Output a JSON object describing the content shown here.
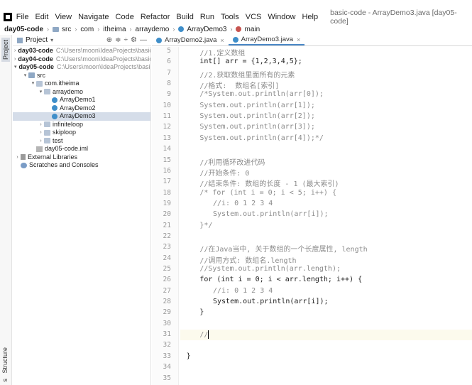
{
  "menubar": {
    "items": [
      "File",
      "Edit",
      "View",
      "Navigate",
      "Code",
      "Refactor",
      "Build",
      "Run",
      "Tools",
      "VCS",
      "Window",
      "Help"
    ],
    "window_title": "basic-code - ArrayDemo3.java [day05-code]"
  },
  "breadcrumb": [
    "day05-code",
    "src",
    "com",
    "itheima",
    "arraydemo",
    "ArrayDemo3",
    "main"
  ],
  "project_panel": {
    "title": "Project",
    "tools": [
      "⊕",
      "≑",
      "÷",
      "⚙",
      "—"
    ],
    "tree": [
      {
        "indent": 0,
        "arrow": ">",
        "icon": "folder",
        "name": "day03-code",
        "bold": true,
        "path": "C:\\Users\\moon\\IdeaProjects\\basic-code"
      },
      {
        "indent": 0,
        "arrow": ">",
        "icon": "folder",
        "name": "day04-code",
        "bold": true,
        "path": "C:\\Users\\moon\\IdeaProjects\\basic-code"
      },
      {
        "indent": 0,
        "arrow": "v",
        "icon": "folder",
        "name": "day05-code",
        "bold": true,
        "path": "C:\\Users\\moon\\IdeaProjects\\basic-code"
      },
      {
        "indent": 1,
        "arrow": "v",
        "icon": "folder",
        "name": "src",
        "bold": false,
        "path": ""
      },
      {
        "indent": 2,
        "arrow": "v",
        "icon": "pkg",
        "name": "com.itheima",
        "bold": false,
        "path": ""
      },
      {
        "indent": 3,
        "arrow": "v",
        "icon": "pkg",
        "name": "arraydemo",
        "bold": false,
        "path": ""
      },
      {
        "indent": 4,
        "arrow": "",
        "icon": "cls",
        "name": "ArrayDemo1",
        "bold": false,
        "path": ""
      },
      {
        "indent": 4,
        "arrow": "",
        "icon": "cls",
        "name": "ArrayDemo2",
        "bold": false,
        "path": ""
      },
      {
        "indent": 4,
        "arrow": "",
        "icon": "cls",
        "name": "ArrayDemo3",
        "bold": false,
        "path": "",
        "selected": true
      },
      {
        "indent": 3,
        "arrow": ">",
        "icon": "pkg",
        "name": "infiniteloop",
        "bold": false,
        "path": ""
      },
      {
        "indent": 3,
        "arrow": ">",
        "icon": "pkg",
        "name": "skiploop",
        "bold": false,
        "path": ""
      },
      {
        "indent": 3,
        "arrow": ">",
        "icon": "pkg",
        "name": "test",
        "bold": false,
        "path": ""
      },
      {
        "indent": 2,
        "arrow": "",
        "icon": "iml",
        "name": "day05-code.iml",
        "bold": false,
        "path": ""
      },
      {
        "indent": 0,
        "arrow": ">",
        "icon": "lib",
        "name": "External Libraries",
        "bold": false,
        "path": ""
      },
      {
        "indent": 0,
        "arrow": "",
        "icon": "scr",
        "name": "Scratches and Consoles",
        "bold": false,
        "path": ""
      }
    ]
  },
  "side_tabs": {
    "project": "Project",
    "structure": "Structure",
    "bottom": "s"
  },
  "tabs": [
    {
      "label": "ArrayDemo2.java",
      "active": false
    },
    {
      "label": "ArrayDemo3.java",
      "active": true
    }
  ],
  "editor": {
    "line_numbers": [
      "5",
      "6",
      "7",
      "8",
      "9",
      "10",
      "11",
      "12",
      "13",
      "14",
      "15",
      "16",
      "17",
      "18",
      "19",
      "20",
      "21",
      "22",
      "23",
      "24",
      "25",
      "26",
      "27",
      "28",
      "29",
      "30",
      "31",
      "32",
      "33",
      "34",
      "35"
    ],
    "current_line": "31",
    "lines": [
      {
        "n": "5",
        "indent": 4,
        "t": "//1.定义数组",
        "style": "comment"
      },
      {
        "n": "6",
        "indent": 4,
        "t": "int[] arr = {1,2,3,4,5};",
        "style": "code"
      },
      {
        "n": "7",
        "indent": 4,
        "t": "//2.获取数组里面所有的元素",
        "style": "comment"
      },
      {
        "n": "8",
        "indent": 4,
        "t": "//格式:  数组名[索引]",
        "style": "comment"
      },
      {
        "n": "9",
        "indent": 4,
        "t": "/*System.out.println(arr[0]);",
        "style": "comment"
      },
      {
        "n": "10",
        "indent": 4,
        "t": "System.out.println(arr[1]);",
        "style": "comment"
      },
      {
        "n": "11",
        "indent": 4,
        "t": "System.out.println(arr[2]);",
        "style": "comment"
      },
      {
        "n": "12",
        "indent": 4,
        "t": "System.out.println(arr[3]);",
        "style": "comment"
      },
      {
        "n": "13",
        "indent": 4,
        "t": "System.out.println(arr[4]);*/",
        "style": "comment"
      },
      {
        "n": "14",
        "indent": 4,
        "t": "",
        "style": "code"
      },
      {
        "n": "15",
        "indent": 4,
        "t": "//利用循环改进代码",
        "style": "comment"
      },
      {
        "n": "16",
        "indent": 4,
        "t": "//开始条件: 0",
        "style": "comment"
      },
      {
        "n": "17",
        "indent": 4,
        "t": "//结束条件: 数组的长度 - 1 (最大索引)",
        "style": "comment"
      },
      {
        "n": "18",
        "indent": 4,
        "t": "/* for (int i = 0; i < 5; i++) {",
        "style": "comment"
      },
      {
        "n": "19",
        "indent": 6,
        "t": "//i: 0 1 2 3 4",
        "style": "comment"
      },
      {
        "n": "20",
        "indent": 6,
        "t": "System.out.println(arr[i]);",
        "style": "comment"
      },
      {
        "n": "21",
        "indent": 4,
        "t": "}*/",
        "style": "comment"
      },
      {
        "n": "22",
        "indent": 4,
        "t": "",
        "style": "code"
      },
      {
        "n": "23",
        "indent": 4,
        "t": "//在Java当中, 关于数组的一个长度属性, length",
        "style": "comment"
      },
      {
        "n": "24",
        "indent": 4,
        "t": "//调用方式: 数组名.length",
        "style": "comment"
      },
      {
        "n": "25",
        "indent": 4,
        "t": "//System.out.println(arr.length);",
        "style": "comment"
      },
      {
        "n": "26",
        "indent": 4,
        "t": "for (int i = 0; i < arr.length; i++) {",
        "style": "code"
      },
      {
        "n": "27",
        "indent": 6,
        "t": "//i: 0 1 2 3 4",
        "style": "comment"
      },
      {
        "n": "28",
        "indent": 6,
        "t": "System.out.println(arr[i]);",
        "style": "code"
      },
      {
        "n": "29",
        "indent": 4,
        "t": "}",
        "style": "code"
      },
      {
        "n": "30",
        "indent": 4,
        "t": "",
        "style": "code"
      },
      {
        "n": "31",
        "indent": 4,
        "t": "//",
        "style": "comment"
      },
      {
        "n": "32",
        "indent": 2,
        "t": "",
        "style": "code"
      },
      {
        "n": "33",
        "indent": 2,
        "t": "}",
        "style": "code"
      },
      {
        "n": "34",
        "indent": 0,
        "t": "}",
        "style": "code"
      },
      {
        "n": "35",
        "indent": 0,
        "t": "",
        "style": "code"
      }
    ]
  }
}
